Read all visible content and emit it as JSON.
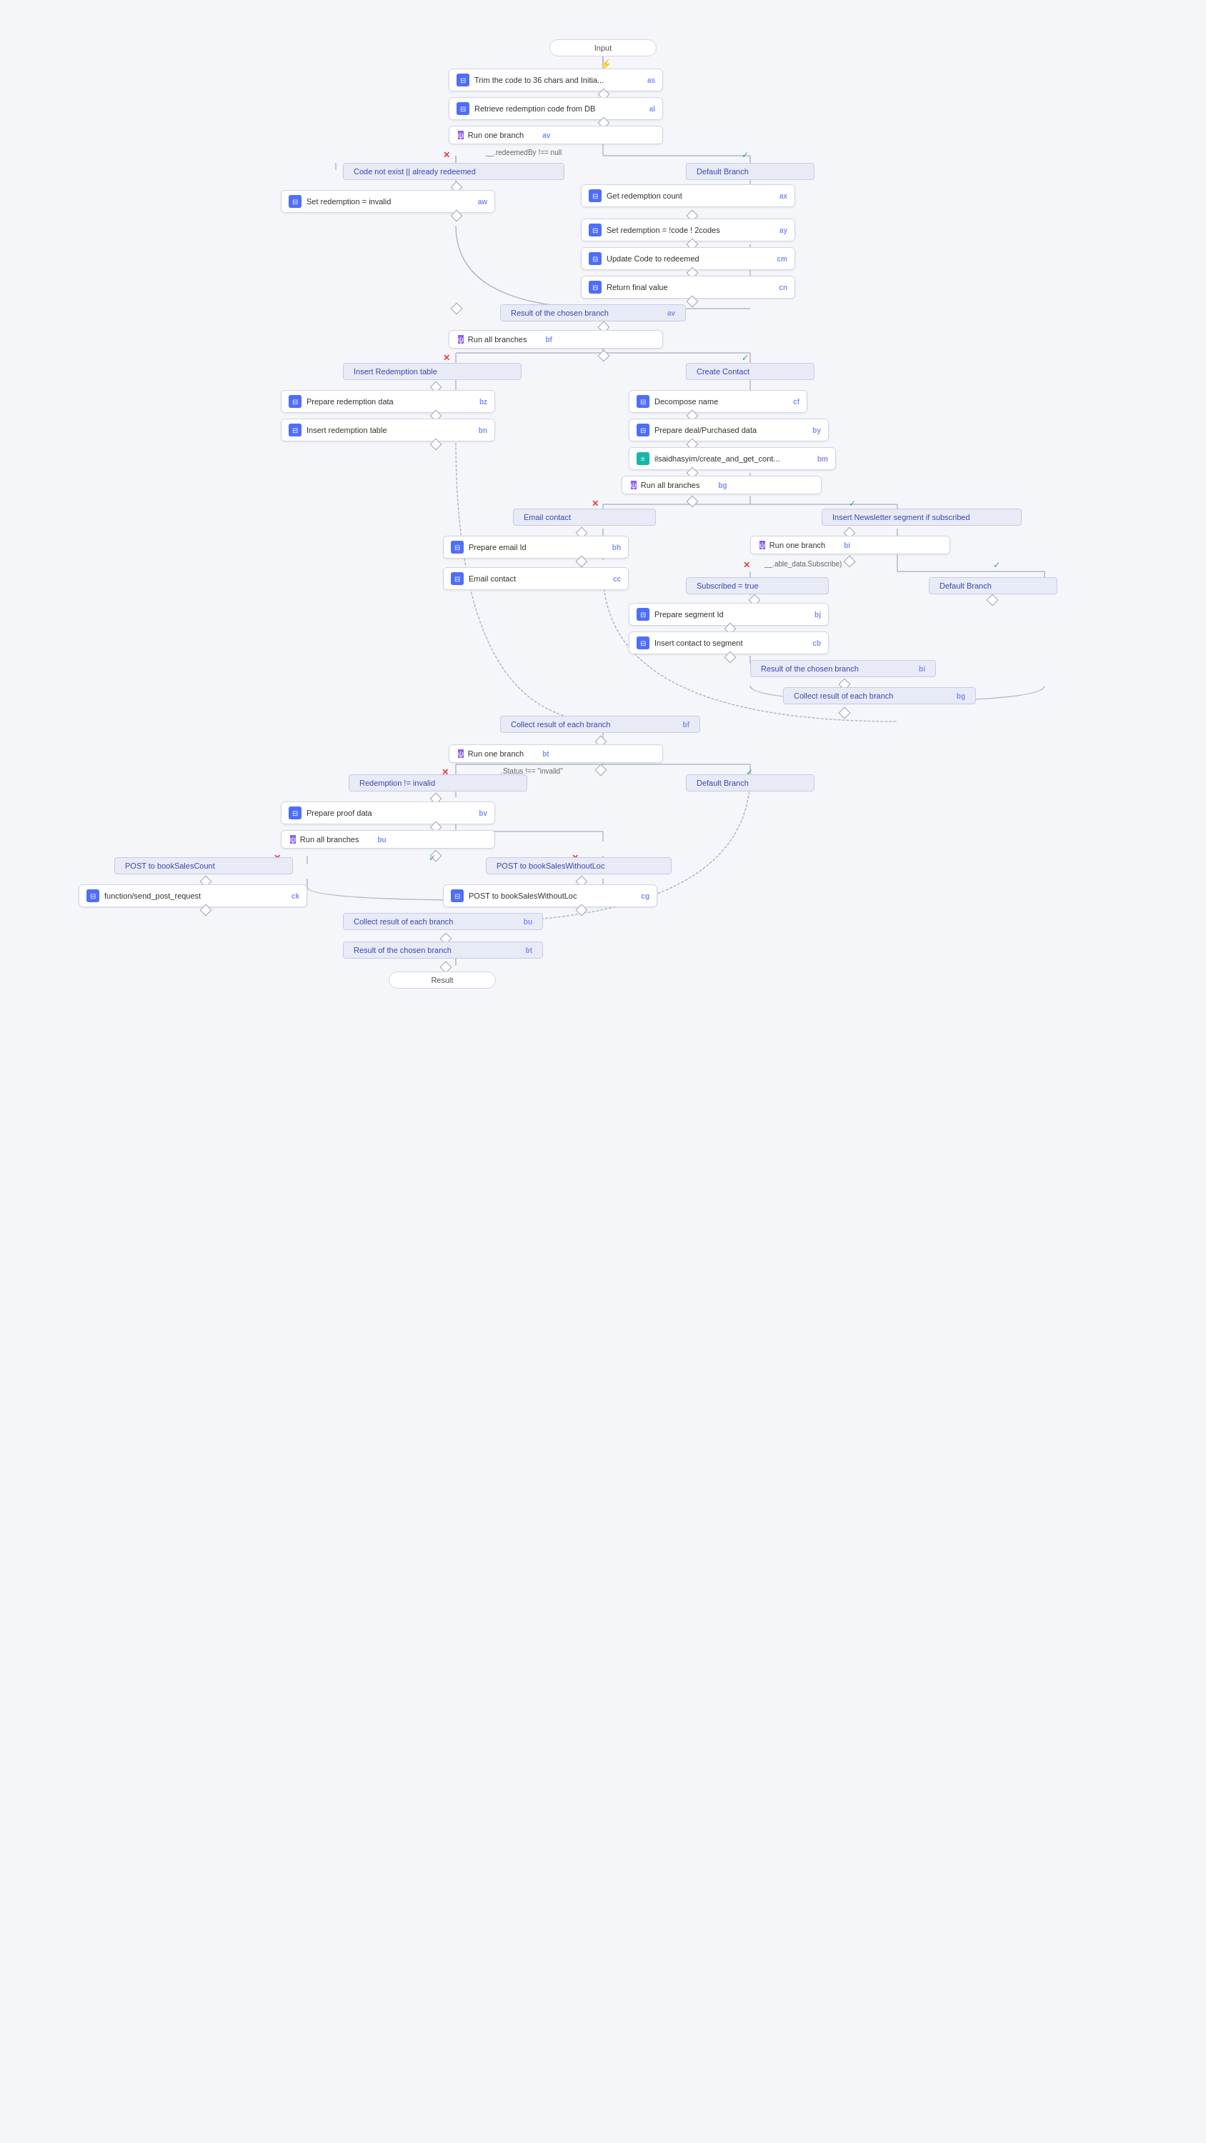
{
  "nodes": {
    "input": {
      "label": "Input",
      "badge": ""
    },
    "trim": {
      "label": "Trim the code to 36 chars and Initia...",
      "badge": "as",
      "icon": "⊟"
    },
    "retrieve": {
      "label": "Retrieve redemption code from DB",
      "badge": "al",
      "icon": "⊟"
    },
    "runOneBranch1": {
      "label": "Run one branch",
      "badge": "av",
      "icon": "ψ"
    },
    "codeNotExist": {
      "label": "Code not exist || already redeemed",
      "badge": ""
    },
    "defaultBranch1": {
      "label": "Default Branch",
      "badge": ""
    },
    "setRedemption": {
      "label": "Set redemption = invalid",
      "badge": "aw",
      "icon": "⊟"
    },
    "getRedemptionCount": {
      "label": "Get redemption count",
      "badge": "ax",
      "icon": "⊟"
    },
    "setRedemption2": {
      "label": "Set redemption = !code ! 2codes",
      "badge": "ay",
      "icon": "⊟"
    },
    "updateCode": {
      "label": "Update Code to redeemed",
      "badge": "cm",
      "icon": "⊟"
    },
    "returnFinal": {
      "label": "Return final value",
      "badge": "cn",
      "icon": "⊟"
    },
    "resultChosen1": {
      "label": "Result of the chosen branch",
      "badge": "av"
    },
    "runAllBranches1": {
      "label": "Run all branches",
      "badge": "bf",
      "icon": "ψ"
    },
    "insertRedemptionTable": {
      "label": "Insert Redemption table",
      "badge": ""
    },
    "createContact": {
      "label": "Create Contact",
      "badge": ""
    },
    "prepareRedemptionData": {
      "label": "Prepare redemption data",
      "badge": "bz",
      "icon": "⊟"
    },
    "decomposeName": {
      "label": "Decompose name",
      "badge": "cf",
      "icon": "⊟"
    },
    "insertRedemptionTable2": {
      "label": "Insert redemption table",
      "badge": "bn",
      "icon": "⊟"
    },
    "prepareDealPurchased": {
      "label": "Prepare deal/Purchased data",
      "badge": "by",
      "icon": "⊟"
    },
    "ilsaidhasyim": {
      "label": "ilsaidhasyim/create_and_get_cont...",
      "badge": "bm",
      "icon": "≡"
    },
    "runAllBranches2": {
      "label": "Run all branches",
      "badge": "bg",
      "icon": "ψ"
    },
    "emailContact": {
      "label": "Email contact",
      "badge": ""
    },
    "insertNewsletter": {
      "label": "Insert Newsletter segment if subscribed",
      "badge": ""
    },
    "prepareEmailId": {
      "label": "Prepare email Id",
      "badge": "bh",
      "icon": "⊟"
    },
    "runOneBranch2": {
      "label": "Run one branch",
      "badge": "bi",
      "icon": "ψ"
    },
    "emailContact2": {
      "label": "Email contact",
      "badge": "cc",
      "icon": "⊟"
    },
    "subscribed": {
      "label": "Subscribed = true",
      "badge": ""
    },
    "defaultBranch2": {
      "label": "Default Branch",
      "badge": ""
    },
    "prepareSegmentId": {
      "label": "Prepare segment Id",
      "badge": "bj",
      "icon": "⊟"
    },
    "insertContactSegment": {
      "label": "Insert contact to segment",
      "badge": "cb",
      "icon": "⊟"
    },
    "resultChosenBranch2": {
      "label": "Result of the chosen branch",
      "badge": "bi"
    },
    "collectResult1": {
      "label": "Collect result of each branch",
      "badge": "bg"
    },
    "collectResult2": {
      "label": "Collect result of each branch",
      "badge": "bf"
    },
    "runOneBranch3": {
      "label": "Run one branch",
      "badge": "bt",
      "icon": "ψ"
    },
    "redemptionInvalid": {
      "label": "Redemption != invalid",
      "badge": ""
    },
    "defaultBranch3": {
      "label": "Default Branch",
      "badge": ""
    },
    "prepareProofData": {
      "label": "Prepare proof data",
      "badge": "bv",
      "icon": "⊟"
    },
    "runAllBranches3": {
      "label": "Run all branches",
      "badge": "bu",
      "icon": "ψ"
    },
    "postBookSalesCount": {
      "label": "POST to bookSalesCount",
      "badge": ""
    },
    "postBookSalesWithoutLoc": {
      "label": "POST to bookSalesWithoutLoc",
      "badge": ""
    },
    "functionSendPost": {
      "label": "function/send_post_request",
      "badge": "ck",
      "icon": "⊟"
    },
    "postBookSalesWithoutLoc2": {
      "label": "POST to bookSalesWithoutLoc",
      "badge": "cg",
      "icon": "⊟"
    },
    "collectResult3": {
      "label": "Collect result of each branch",
      "badge": "bu"
    },
    "resultChosenBranch3": {
      "label": "Result of the chosen branch",
      "badge": "bt"
    },
    "result": {
      "label": "Result",
      "badge": ""
    }
  },
  "labels": {
    "redeemedBy": "__.redeemedBy !== null",
    "statusInvalid": "__.Status !== \"invalid\"",
    "sable_data": "__.able_data.Subscribe)"
  }
}
